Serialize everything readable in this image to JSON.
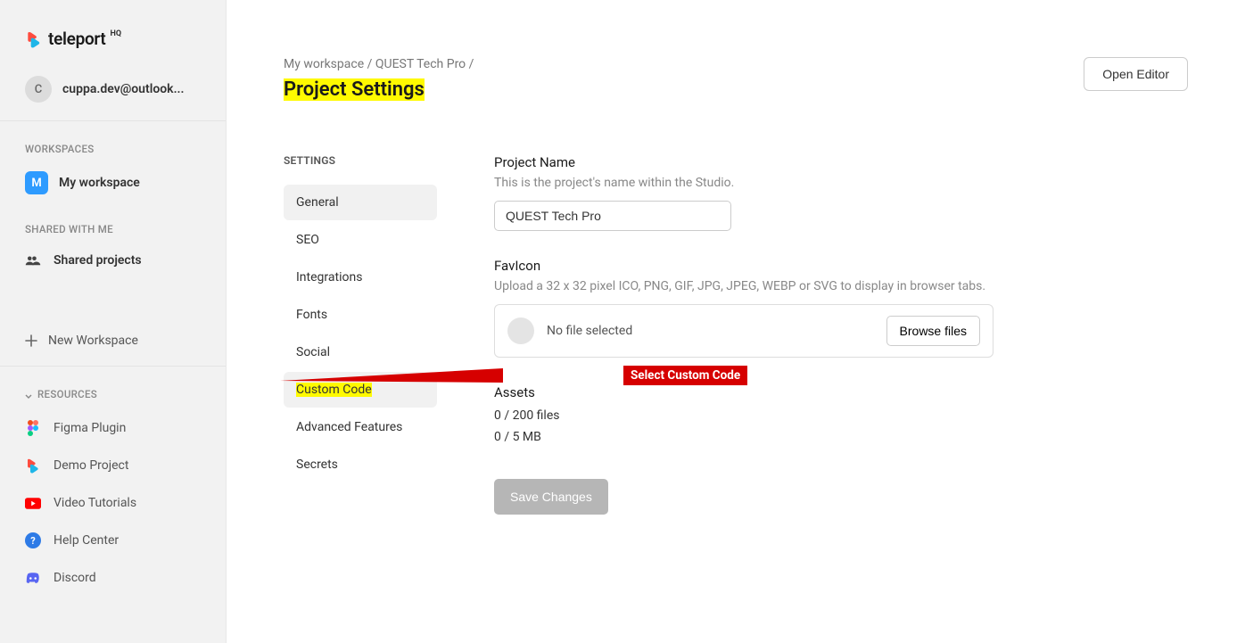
{
  "brand": {
    "name": "teleport",
    "suffix": "HQ"
  },
  "user": {
    "initial": "C",
    "email": "cuppa.dev@outlook..."
  },
  "sidebar": {
    "workspaces_label": "WORKSPACES",
    "workspace": {
      "initial": "M",
      "name": "My workspace"
    },
    "shared_label": "SHARED WITH ME",
    "shared_projects": "Shared projects",
    "new_workspace": "New Workspace",
    "resources_label": "RESOURCES",
    "resources": [
      {
        "label": "Figma Plugin"
      },
      {
        "label": "Demo Project"
      },
      {
        "label": "Video Tutorials"
      },
      {
        "label": "Help Center"
      },
      {
        "label": "Discord"
      }
    ]
  },
  "breadcrumb": {
    "workspace": "My workspace",
    "project": "QUEST Tech Pro"
  },
  "page_title": "Project Settings",
  "open_editor": "Open Editor",
  "settings_nav": {
    "heading": "SETTINGS",
    "tabs": [
      "General",
      "SEO",
      "Integrations",
      "Fonts",
      "Social",
      "Custom Code",
      "Advanced Features",
      "Secrets"
    ]
  },
  "form": {
    "project_name": {
      "label": "Project Name",
      "desc": "This is the project's name within the Studio.",
      "value": "QUEST Tech Pro"
    },
    "favicon": {
      "label": "FavIcon",
      "desc": "Upload a 32 x 32 pixel ICO, PNG, GIF, JPG, JPEG, WEBP or SVG to display in browser tabs.",
      "status": "No file selected",
      "browse": "Browse files"
    },
    "assets": {
      "label": "Assets",
      "files": "0 / 200 files",
      "size": "0 / 5 MB"
    },
    "save": "Save Changes"
  },
  "annotation": {
    "label": "Select Custom Code"
  }
}
